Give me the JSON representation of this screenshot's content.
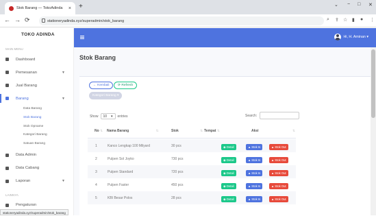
{
  "browser": {
    "tab_title": "Stok Barang — TokoAdinda",
    "tab_close": "×",
    "new_tab": "+",
    "url": "stationeryadinda.xyz/superadmin/stok_barang",
    "status_url": "stationeryadinda.xyz/superadmin/stok_barang"
  },
  "sidebar": {
    "brand": "TOKO ADINDA",
    "section_main": "MAIN MENU",
    "items": [
      {
        "label": "Dashboard"
      },
      {
        "label": "Pemesanan"
      },
      {
        "label": "Jual Barang"
      },
      {
        "label": "Barang"
      },
      {
        "label": "Data Admin"
      },
      {
        "label": "Data Cabang"
      },
      {
        "label": "Laporan"
      },
      {
        "label": "Pengaturan"
      }
    ],
    "barang_sub": [
      "Data Barang",
      "Stok Barang",
      "Stok Opname",
      "Kategori Barang",
      "Satuan Barang"
    ],
    "section_lainnya": "LAINNYA"
  },
  "topbar": {
    "user_name": "Hi, H. Aminan"
  },
  "page": {
    "title": "Stok Barang",
    "btn_kembali": "← Kembali",
    "btn_refresh": "⟳ Refresh",
    "btn_kategori": "Kategori Barang ▾",
    "show_label": "Show",
    "show_value": "10",
    "entries_label": "entries",
    "search_label": "Search:"
  },
  "table": {
    "headers": {
      "no": "No",
      "nama": "Nama Barang",
      "stok": "Stok",
      "tempat": "Tempat",
      "aksi": "Aksi"
    },
    "actions": {
      "detail": "◉ Detail",
      "stok_in": "▲ Stok In",
      "stok_out": "▲ Stok Out"
    },
    "rows": [
      {
        "no": "1",
        "nama": "Kanco Lengkap 100 Milyard",
        "stok": "30 pcs"
      },
      {
        "no": "2",
        "nama": "Pulpen Sol Joyko",
        "stok": "730 pcs"
      },
      {
        "no": "3",
        "nama": "Pulpen Standard",
        "stok": "720 pcs"
      },
      {
        "no": "4",
        "nama": "Pulpen Faster",
        "stok": "450 pcs"
      },
      {
        "no": "5",
        "nama": "KBI Besar Polos",
        "stok": "28 pcs"
      }
    ]
  },
  "colors": {
    "primary": "#4e73df",
    "success": "#1cc88a",
    "danger": "#e74a3b"
  }
}
